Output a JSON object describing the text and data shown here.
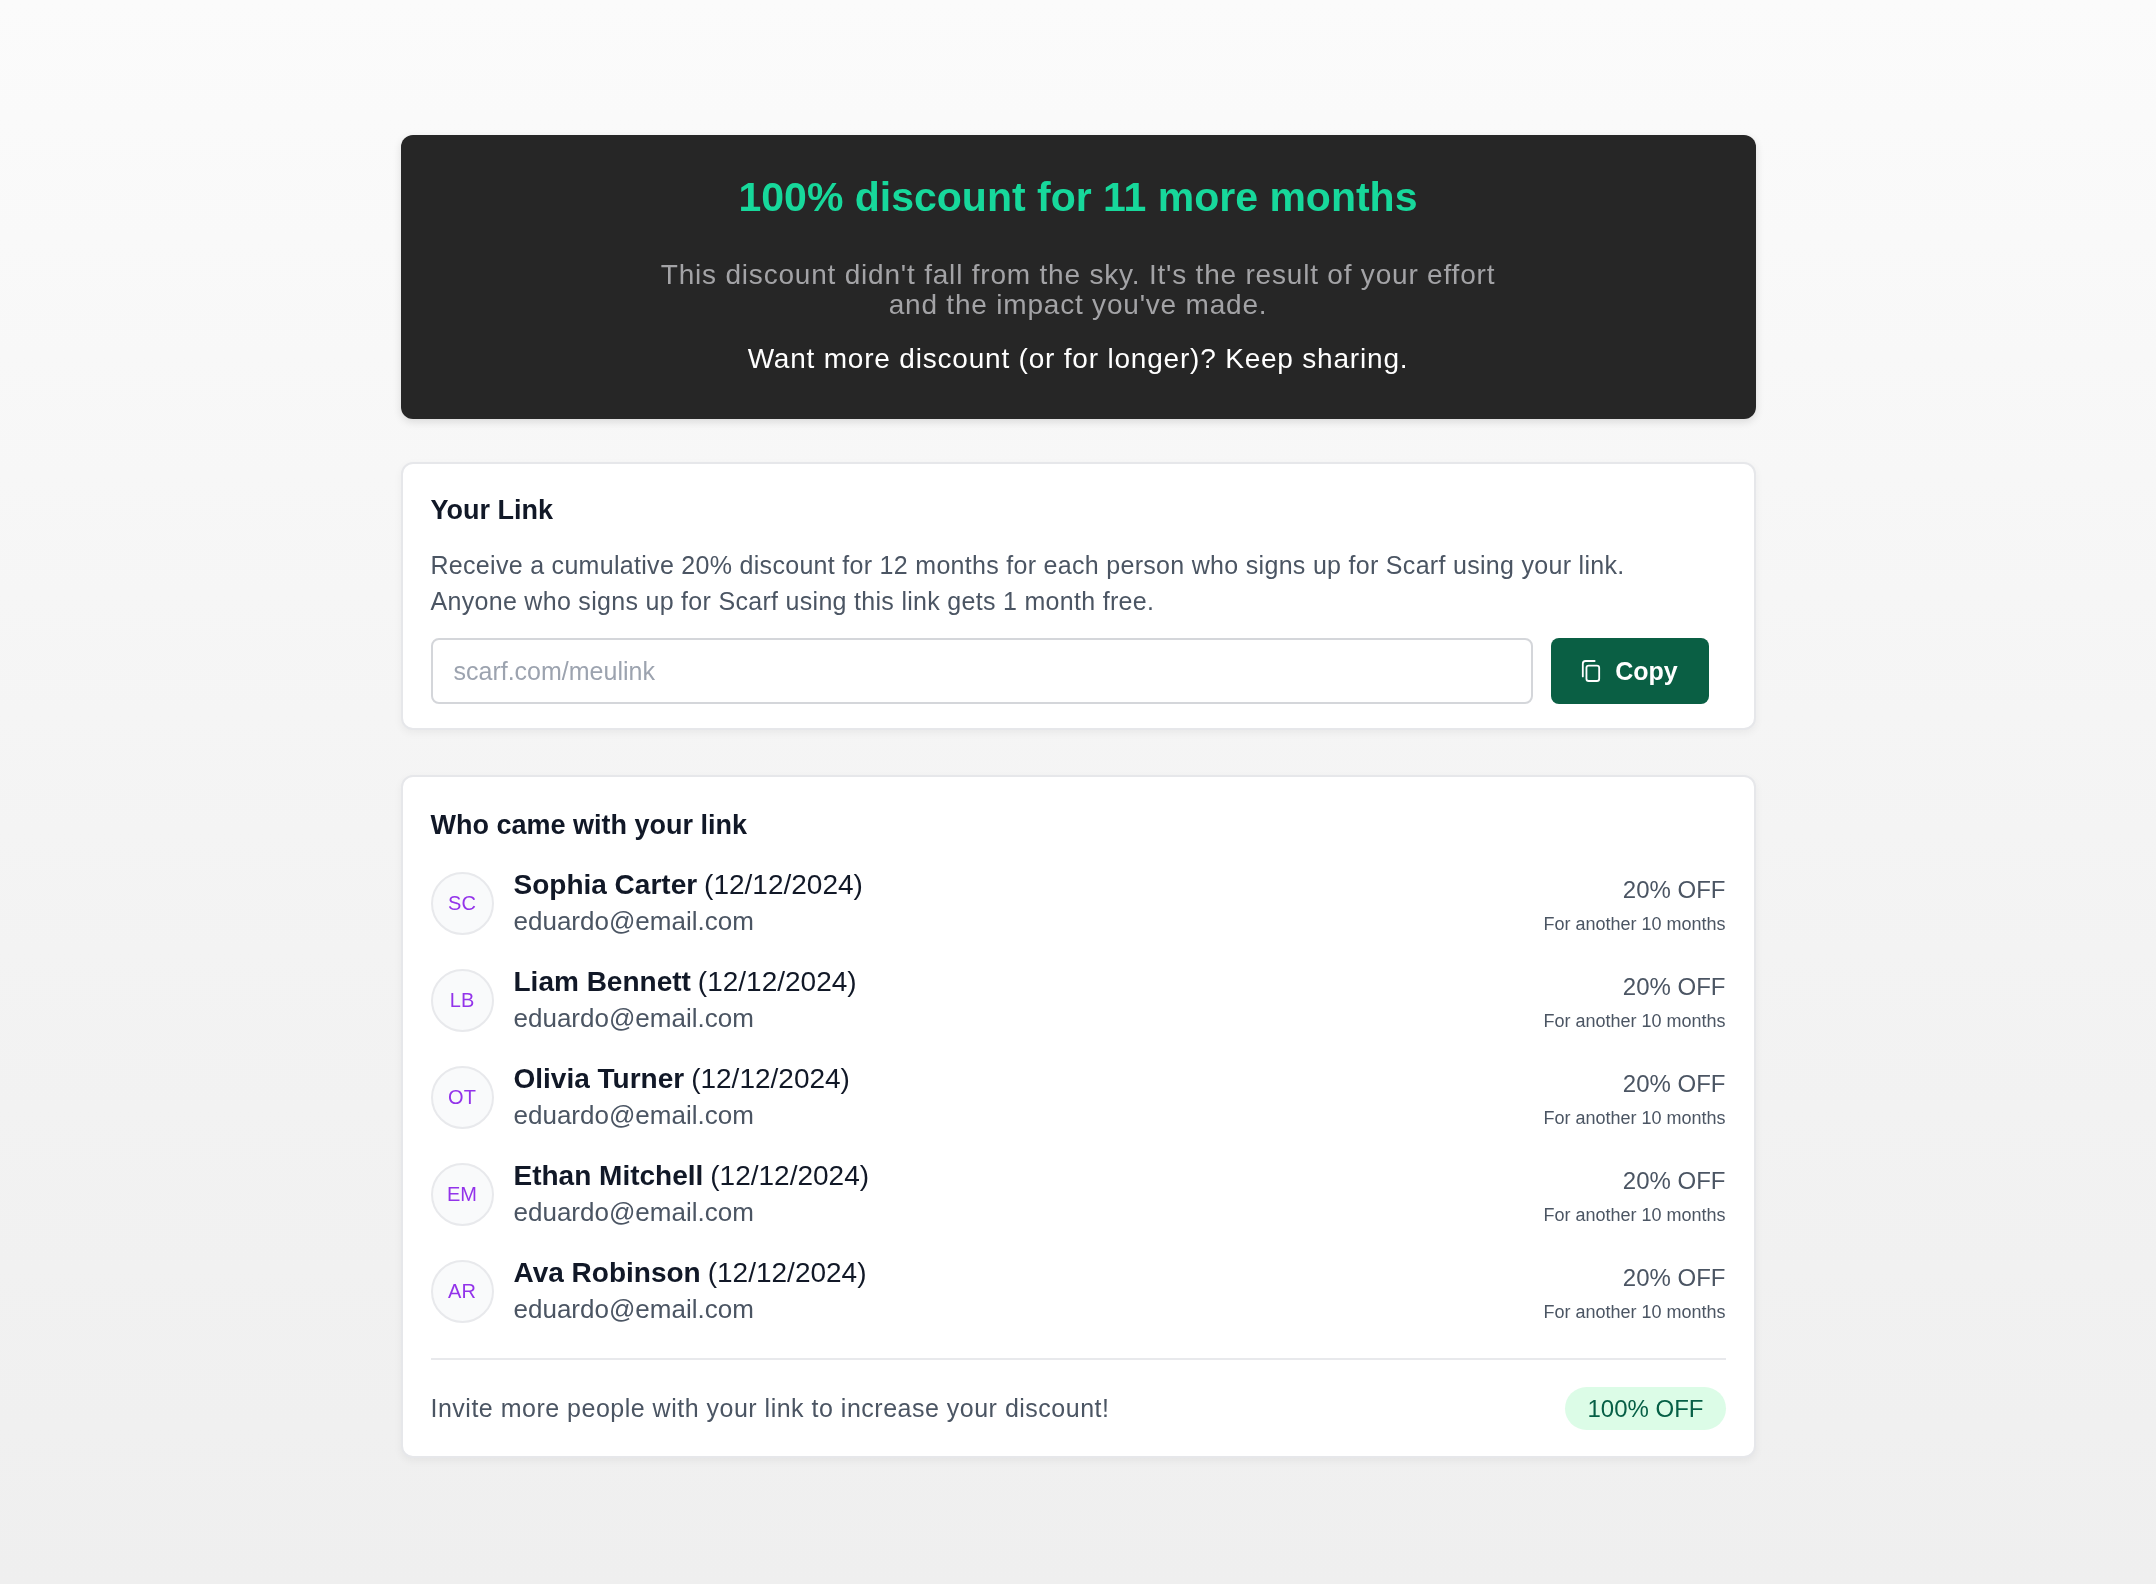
{
  "banner": {
    "title": "100% discount for 11 more months",
    "message": "This discount didn't fall from the sky. It's the result of your effort and the impact you've made.",
    "call_to_action": "Want more discount (or for longer)? Keep sharing."
  },
  "link_card": {
    "title": "Your Link",
    "description": [
      "Receive a cumulative 20% discount for 12 months for each person who signs up for Scarf using your link.",
      "Anyone who signs up for Scarf using this link gets 1 month free."
    ],
    "link_field": {
      "placeholder": "scarf.com/meulink"
    },
    "copy_button": {
      "label": "Copy"
    }
  },
  "referrals": {
    "title": "Who came with your link",
    "people": [
      {
        "initials": "SC",
        "name": "Sophia Carter",
        "date": "(12/12/2024)",
        "email": "eduardo@email.com",
        "discount": "20% OFF",
        "duration": "For another 10 months"
      },
      {
        "initials": "LB",
        "name": "Liam Bennett",
        "date": "(12/12/2024)",
        "email": "eduardo@email.com",
        "discount": "20% OFF",
        "duration": "For another 10 months"
      },
      {
        "initials": "OT",
        "name": "Olivia Turner",
        "date": "(12/12/2024)",
        "email": "eduardo@email.com",
        "discount": "20% OFF",
        "duration": "For another 10 months"
      },
      {
        "initials": "EM",
        "name": "Ethan Mitchell",
        "date": "(12/12/2024)",
        "email": "eduardo@email.com",
        "discount": "20% OFF",
        "duration": "For another 10 months"
      },
      {
        "initials": "AR",
        "name": "Ava Robinson",
        "date": "(12/12/2024)",
        "email": "eduardo@email.com",
        "discount": "20% OFF",
        "duration": "For another 10 months"
      }
    ],
    "footer": {
      "message": "Invite more people with your link to increase your discount!",
      "total_badge": "100% OFF"
    }
  }
}
